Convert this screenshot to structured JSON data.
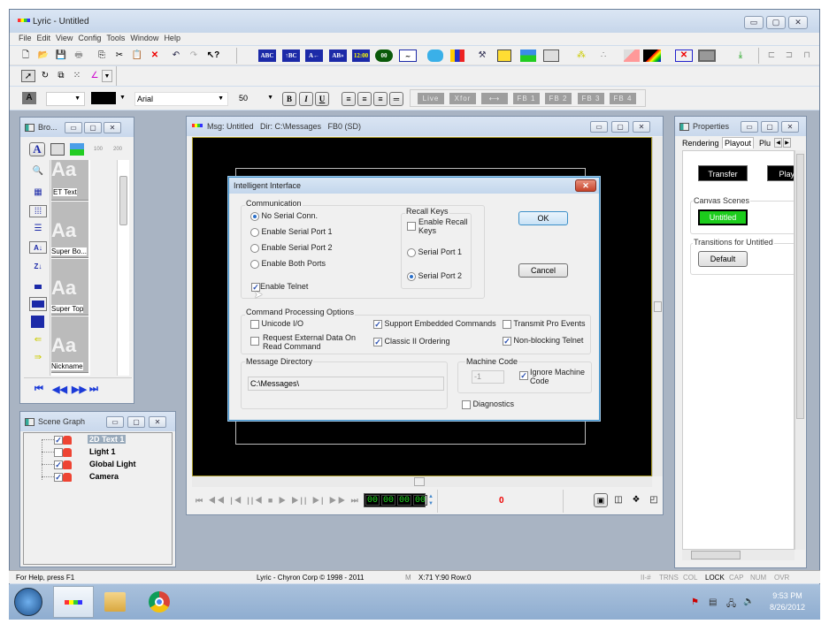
{
  "app": {
    "title": "Lyric - Untitled"
  },
  "window_controls": {
    "minimize": "▭",
    "maximize": "▢",
    "close": "✕"
  },
  "menu": [
    "File",
    "Edit",
    "View",
    "Config",
    "Tools",
    "Window",
    "Help"
  ],
  "toolbar_main": {
    "file_icons": [
      "new-icon",
      "open-icon",
      "save-icon",
      "print-icon",
      "copy-icon",
      "cut-icon",
      "paste-icon",
      "delete-icon",
      "undo-icon",
      "redo-icon",
      "context-help-icon"
    ],
    "text_icons": [
      {
        "name": "text-abc",
        "label": "ABC"
      },
      {
        "name": "crawl-abc",
        "label": "↑BC"
      },
      {
        "name": "roll-abc",
        "label": "A←"
      },
      {
        "name": "effects-abc",
        "label": "AB»"
      },
      {
        "name": "clock",
        "label": "12:00"
      },
      {
        "name": "counter",
        "label": "00"
      },
      {
        "name": "wave",
        "label": "∼"
      }
    ],
    "object_icons": [
      "teapot-icon",
      "primitives-icon",
      "satellite-icon",
      "image-icon",
      "landscape-icon",
      "template-icon",
      "nodes-icon",
      "points-icon",
      "eraser-icon",
      "gradient-icon",
      "no-output-icon",
      "monitor-icon",
      "import-icon"
    ],
    "right_icons": [
      "align-left-icon",
      "align-right-icon",
      "distribute-icon"
    ]
  },
  "toolbar_tools": [
    "select-icon",
    "rotate-icon",
    "scale-icon",
    "center-icon",
    "axes-icon"
  ],
  "format_bar": {
    "style_value": "",
    "color_value": "#000000",
    "font": "Arial",
    "size": "50",
    "bold": "B",
    "italic": "I",
    "underline": "U",
    "align_icons": [
      "align-left",
      "align-center",
      "align-right",
      "justify"
    ],
    "output_buttons": [
      "Live",
      "Xfor",
      "⟷",
      "FB 1",
      "FB 2",
      "FB 3",
      "FB 4"
    ]
  },
  "browser_panel": {
    "title": "Bro...",
    "top_tabs": [
      "A",
      "tmpl",
      "img",
      "100",
      "200"
    ],
    "items": [
      {
        "label": "ET Text"
      },
      {
        "label": "Super Bo..."
      },
      {
        "label": "Super Top"
      },
      {
        "label": "Nickname"
      }
    ],
    "side_tools": [
      "search-icon",
      "grid-icon",
      "large-icons-icon",
      "list-icon",
      "sort-az-icon",
      "sort-za-icon",
      "small-size-icon",
      "medium-size-icon",
      "large-size-icon",
      "import-icon",
      "export-icon"
    ],
    "nav": [
      "⏮",
      "◀◀",
      "▶▶",
      "⏭"
    ]
  },
  "scene_graph": {
    "title": "Scene Graph",
    "items": [
      {
        "label": "2D Text 1",
        "checked": true,
        "selected": true
      },
      {
        "label": "Light 1",
        "checked": false,
        "selected": false
      },
      {
        "label": "Global Light",
        "checked": true,
        "selected": false
      },
      {
        "label": "Camera",
        "checked": true,
        "selected": false
      }
    ]
  },
  "canvas_window": {
    "title": "Msg: Untitled   Dir: C:\\Messages   FB0 (SD)",
    "transport": [
      "⏮",
      "◀◀",
      "|◀",
      "||◀",
      "■",
      "▶",
      "▶||",
      "▶|",
      "▶▶",
      "⏭"
    ],
    "timecode": [
      "00",
      "00",
      "00",
      "00"
    ],
    "counter": "0",
    "view_icons": [
      "view-front-icon",
      "view-wire-icon",
      "view-solid-icon",
      "view-perspective-icon"
    ]
  },
  "dialog": {
    "title": "Intelligent Interface",
    "communication": {
      "label": "Communication",
      "options": [
        {
          "label": "No Serial Conn.",
          "selected": true
        },
        {
          "label": "Enable Serial Port 1",
          "selected": false
        },
        {
          "label": "Enable Serial Port 2",
          "selected": false
        },
        {
          "label": "Enable Both Ports",
          "selected": false
        }
      ],
      "telnet": {
        "label": "Enable Telnet",
        "checked": true
      }
    },
    "recall_keys": {
      "label": "Recall Keys",
      "enable": {
        "label": "Enable Recall Keys",
        "checked": false
      },
      "ports": [
        {
          "label": "Serial Port 1",
          "selected": false
        },
        {
          "label": "Serial Port 2",
          "selected": true
        }
      ]
    },
    "ok": "OK",
    "cancel": "Cancel",
    "command_options": {
      "label": "Command Processing Options",
      "items": [
        {
          "label": "Unicode I/O",
          "checked": false
        },
        {
          "label": "Request External Data On Read Command",
          "checked": false
        },
        {
          "label": "Support Embedded Commands",
          "checked": true
        },
        {
          "label": "Classic II Ordering",
          "checked": true
        },
        {
          "label": "Transmit Pro Events",
          "checked": false
        },
        {
          "label": "Non-blocking Telnet",
          "checked": true
        }
      ]
    },
    "message_directory": {
      "label": "Message Directory",
      "value": "C:\\Messages\\"
    },
    "machine_code": {
      "label": "Machine Code",
      "value": "-1",
      "ignore": {
        "label": "Ignore Machine Code",
        "checked": true
      }
    },
    "diagnostics": {
      "label": "Diagnostics",
      "checked": false
    }
  },
  "properties": {
    "title": "Properties",
    "tabs": [
      "Rendering",
      "Playout",
      "Plu"
    ],
    "active_tab": "Playout",
    "transfer": "Transfer",
    "play": "Play",
    "canvas_scenes_label": "Canvas Scenes",
    "scene": "Untitled",
    "transitions_label": "Transitions for Untitled",
    "transition": "Default"
  },
  "statusbar": {
    "help": "For Help, press F1",
    "copyright": "Lyric - Chyron Corp © 1998 - 2011",
    "mode": "M",
    "coords": "X:71  Y:90  Row:0",
    "indicators": [
      "II-#",
      "TRNS",
      "COL",
      "LOCK",
      "CAP",
      "NUM",
      "OVR"
    ],
    "active_indicator": "LOCK"
  },
  "taskbar": {
    "time": "9:53 PM",
    "date": "8/26/2012"
  }
}
